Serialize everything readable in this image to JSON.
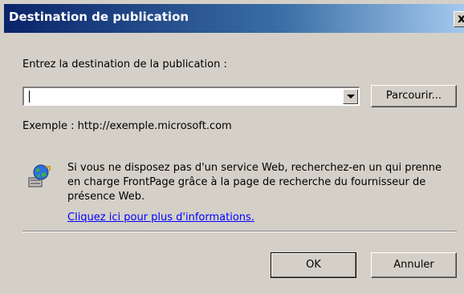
{
  "window": {
    "title": "Destination de publication",
    "close_label": "x"
  },
  "form": {
    "destination_label": "Entrez la destination de la publication :",
    "destination_value": "",
    "browse_label": "Parcourir...",
    "example_text": "Exemple : http://exemple.microsoft.com"
  },
  "info": {
    "text": "Si vous ne disposez pas d'un service Web, recherchez-en un qui prenne en charge FrontPage grâce à la page de recherche du fournisseur de présence Web.",
    "link_text": "Cliquez ici pour plus d'informations.",
    "icon": "web-publish-globe-icon"
  },
  "buttons": {
    "ok_label": "OK",
    "cancel_label": "Annuler"
  },
  "colors": {
    "titlebar_start": "#0a246a",
    "titlebar_end": "#a6caf0",
    "dialog_bg": "#d4d0c8",
    "link": "#0000ff"
  }
}
